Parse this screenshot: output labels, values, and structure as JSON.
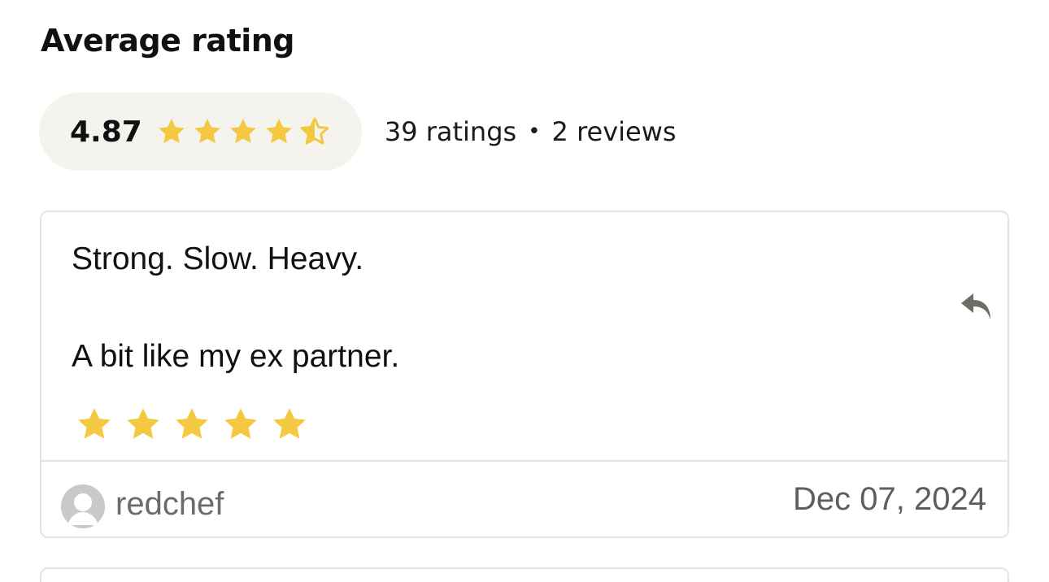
{
  "heading": "Average rating",
  "summary": {
    "score": "4.87",
    "star_rating": 4.87,
    "ratings_text": "39 ratings",
    "separator": "•",
    "reviews_text": "2 reviews"
  },
  "review": {
    "line1": "Strong. Slow. Heavy.",
    "line2": "A bit like my ex partner.",
    "star_rating": 5,
    "username": "redchef",
    "date": "Dec 07, 2024"
  },
  "icons": {
    "star": "star-icon",
    "half_star": "half-star-icon",
    "reply": "reply-icon",
    "avatar": "user-avatar-icon"
  },
  "colors": {
    "star": "#f5c842",
    "pill_background": "#f4f3ee",
    "reply_icon": "#6e6e66",
    "border": "#e4e4e4"
  }
}
